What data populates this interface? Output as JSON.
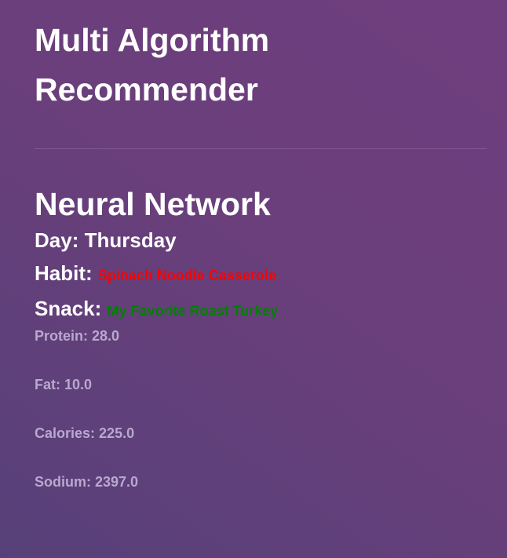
{
  "header": {
    "title_line1": "Multi Algorithm",
    "title_line2": "Recommender"
  },
  "section": {
    "title": "Neural Network",
    "day_label": "Day:",
    "day_value": "Thursday",
    "habit_label": "Habit:",
    "habit_value": "Spinach Noodle Casserole",
    "snack_label": "Snack:",
    "snack_value": "My Favorite Roast Turkey"
  },
  "nutrients": [
    {
      "label": "Protein:",
      "value": "28.0"
    },
    {
      "label": "Fat:",
      "value": "10.0"
    },
    {
      "label": "Calories:",
      "value": "225.0"
    },
    {
      "label": "Sodium:",
      "value": "2397.0"
    }
  ],
  "colors": {
    "habit": "#ff0000",
    "snack": "#008000",
    "nutrient_text": "#b9a8cf",
    "background_start": "#574079",
    "background_end": "#6f3e7e"
  }
}
